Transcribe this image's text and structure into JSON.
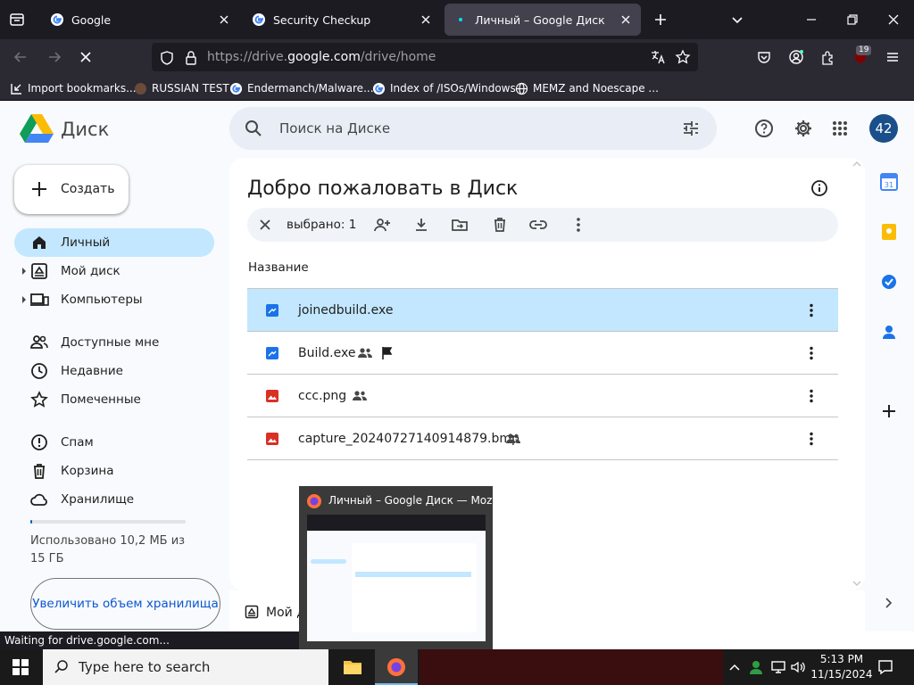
{
  "browser": {
    "tabs": [
      {
        "label": "Google",
        "active": false
      },
      {
        "label": "Security Checkup",
        "active": false
      },
      {
        "label": "Личный – Google Диск",
        "active": true
      }
    ],
    "url_prefix": "https://drive.",
    "url_domain": "google.com",
    "url_path": "/drive/home",
    "extension_badge": "19",
    "bookmarks": [
      "Import bookmarks...",
      "RUSSIAN TEST",
      "Endermanch/Malware...",
      "Index of /ISOs/Windows",
      "MEMZ and Noescape ..."
    ]
  },
  "drive": {
    "title": "Диск",
    "search_placeholder": "Поиск на Диске",
    "avatar": "42",
    "create_label": "Создать",
    "nav": [
      {
        "label": "Личный",
        "icon": "home-icon",
        "selected": true
      },
      {
        "label": "Мой диск",
        "icon": "my-drive-icon"
      },
      {
        "label": "Компьютеры",
        "icon": "computers-icon"
      },
      {
        "label": "Доступные мне",
        "icon": "shared-icon"
      },
      {
        "label": "Недавние",
        "icon": "clock-icon"
      },
      {
        "label": "Помеченные",
        "icon": "star-icon"
      },
      {
        "label": "Спам",
        "icon": "spam-icon"
      },
      {
        "label": "Корзина",
        "icon": "trash-icon"
      },
      {
        "label": "Хранилище",
        "icon": "cloud-icon"
      }
    ],
    "storage_text": "Использовано 10,2 МБ из 15 ГБ",
    "storage_fraction": 0.0007,
    "upgrade_label": "Увеличить объем хранилища",
    "welcome": "Добро пожаловать в Диск",
    "selected_count": "выбрано: 1",
    "column_name": "Название",
    "files": [
      {
        "name": "joinedbuild.exe",
        "type": "exe",
        "shared": false,
        "flag": false,
        "selected": true
      },
      {
        "name": "Build.exe",
        "type": "exe",
        "shared": true,
        "flag": true,
        "selected": false
      },
      {
        "name": "ccc.png",
        "type": "image",
        "shared": true,
        "flag": false,
        "selected": false
      },
      {
        "name": "capture_20240727140914879.bmp",
        "type": "image",
        "shared": true,
        "flag": false,
        "selected": false
      }
    ],
    "bottom_label": "Мой д"
  },
  "status_text": "Waiting for drive.google.com...",
  "preview_title": "Личный – Google Диск — Moz...",
  "taskbar": {
    "search_placeholder": "Type here to search",
    "time": "5:13 PM",
    "date": "11/15/2024"
  },
  "colors": {
    "accent": "#0b57d0",
    "selected_row": "#c2e7ff",
    "exe_icon": "#1a73e8",
    "image_icon": "#d93025"
  }
}
